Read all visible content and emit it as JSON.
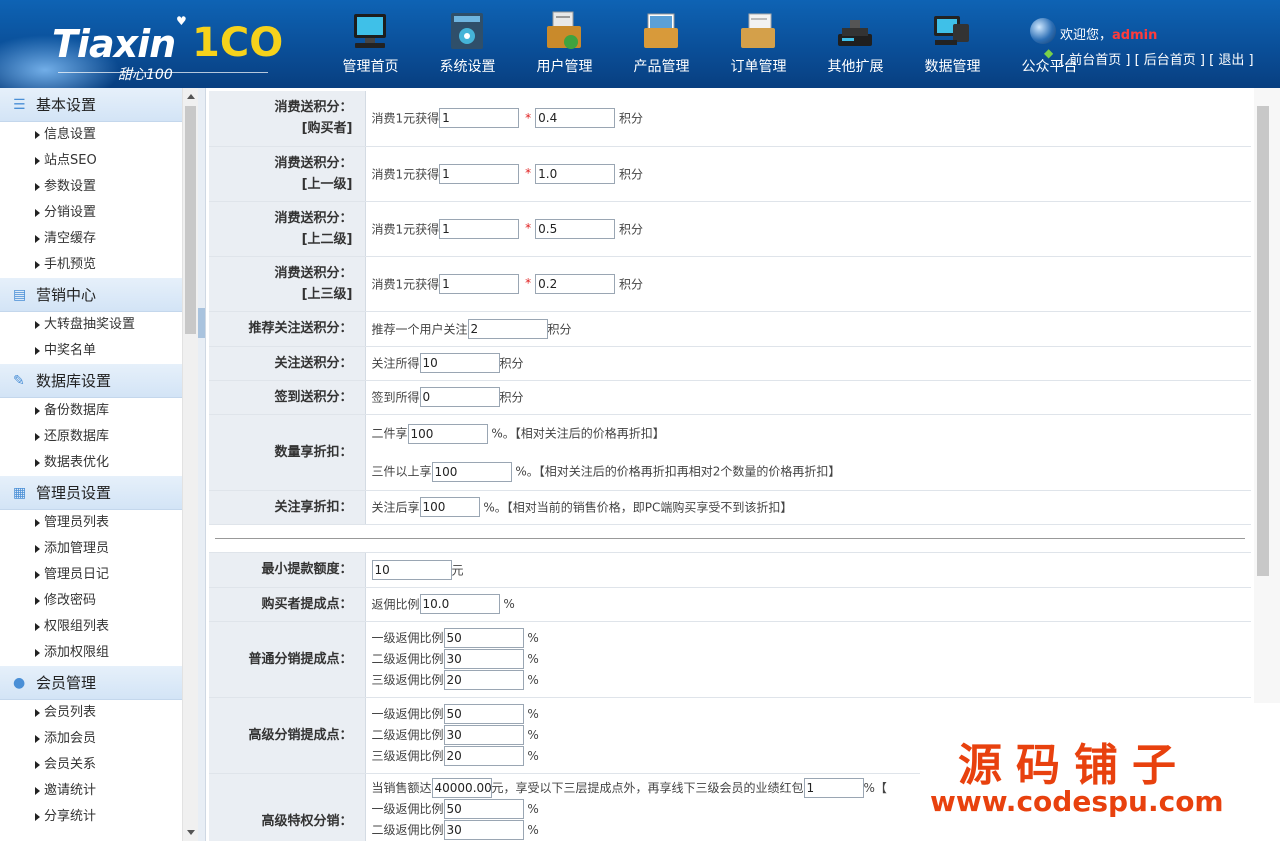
{
  "brand": {
    "logo_word": "Tiaxin",
    "logo_num": "1CO",
    "logo_sub": "甜心100"
  },
  "nav": [
    {
      "label": "管理首页",
      "icon": "monitor-icon"
    },
    {
      "label": "系统设置",
      "icon": "settings-cabinet-icon"
    },
    {
      "label": "用户管理",
      "icon": "user-folder-icon"
    },
    {
      "label": "产品管理",
      "icon": "product-folder-icon"
    },
    {
      "label": "订单管理",
      "icon": "order-folder-icon"
    },
    {
      "label": "其他扩展",
      "icon": "device-icon"
    },
    {
      "label": "数据管理",
      "icon": "data-monitor-icon"
    },
    {
      "label": "公众平台",
      "icon": "globe-icon"
    }
  ],
  "user": {
    "welcome": "欢迎您，",
    "name": "admin",
    "link_front": "[ 前台首页 ]",
    "link_back": "[ 后台首页 ]",
    "link_logout": "[ 退出 ]"
  },
  "sidebar": [
    {
      "title": "基本设置",
      "icon": "list-icon",
      "items": [
        "信息设置",
        "站点SEO",
        "参数设置",
        "分销设置",
        "清空缓存",
        "手机预览"
      ]
    },
    {
      "title": "营销中心",
      "icon": "message-icon",
      "items": [
        "大转盘抽奖设置",
        "中奖名单"
      ]
    },
    {
      "title": "数据库设置",
      "icon": "edit-icon",
      "items": [
        "备份数据库",
        "还原数据库",
        "数据表优化"
      ]
    },
    {
      "title": "管理员设置",
      "icon": "calendar-icon",
      "items": [
        "管理员列表",
        "添加管理员",
        "管理员日记",
        "修改密码",
        "权限组列表",
        "添加权限组"
      ]
    },
    {
      "title": "会员管理",
      "icon": "person-icon",
      "items": [
        "会员列表",
        "添加会员",
        "会员关系",
        "邀请统计",
        "分享统计"
      ]
    }
  ],
  "form": {
    "consume_buyer": {
      "label1": "消费送积分：",
      "label2": "[购买者]",
      "prefix": "消费1元获得",
      "a": "1",
      "b": "0.4",
      "suffix": "积分"
    },
    "consume_l1": {
      "label1": "消费送积分：",
      "label2": "[上一级]",
      "prefix": "消费1元获得",
      "a": "1",
      "b": "1.0",
      "suffix": "积分"
    },
    "consume_l2": {
      "label1": "消费送积分：",
      "label2": "[上二级]",
      "prefix": "消费1元获得",
      "a": "1",
      "b": "0.5",
      "suffix": "积分"
    },
    "consume_l3": {
      "label1": "消费送积分：",
      "label2": "[上三级]",
      "prefix": "消费1元获得",
      "a": "1",
      "b": "0.2",
      "suffix": "积分"
    },
    "recommend": {
      "label": "推荐关注送积分：",
      "prefix": "推荐一个用户关注",
      "value": "2",
      "suffix": "积分"
    },
    "follow": {
      "label": "关注送积分：",
      "prefix": "关注所得",
      "value": "10",
      "suffix": "积分"
    },
    "signin": {
      "label": "签到送积分：",
      "prefix": "签到所得",
      "value": "0",
      "suffix": "积分"
    },
    "qty_discount": {
      "label": "数量享折扣：",
      "p1": "二件享",
      "v1": "100",
      "s1": "%。【相对关注后的价格再折扣】",
      "p2": "三件以上享",
      "v2": "100",
      "s2": "%。【相对关注后的价格再折扣再相对2个数量的价格再折扣】"
    },
    "follow_discount": {
      "label": "关注享折扣：",
      "prefix": "关注后享",
      "value": "100",
      "suffix": "%。【相对当前的销售价格，即PC端购买享受不到该折扣】"
    },
    "min_withdraw": {
      "label": "最小提款额度：",
      "value": "10",
      "suffix": "元"
    },
    "buyer_commission": {
      "label": "购买者提成点：",
      "prefix": "返佣比例",
      "value": "10.0",
      "suffix": "%"
    },
    "normal_dist": {
      "label": "普通分销提成点：",
      "rows": [
        {
          "prefix": "一级返佣比例",
          "value": "50",
          "suffix": "%"
        },
        {
          "prefix": "二级返佣比例",
          "value": "30",
          "suffix": "%"
        },
        {
          "prefix": "三级返佣比例",
          "value": "20",
          "suffix": "%"
        }
      ]
    },
    "senior_dist": {
      "label": "高级分销提成点：",
      "rows": [
        {
          "prefix": "一级返佣比例",
          "value": "50",
          "suffix": "%"
        },
        {
          "prefix": "二级返佣比例",
          "value": "30",
          "suffix": "%"
        },
        {
          "prefix": "三级返佣比例",
          "value": "20",
          "suffix": "%"
        }
      ]
    },
    "senior_special": {
      "label": "高级特权分销：",
      "p0": "当销售额达",
      "v0": "40000.00",
      "m0": "元，享受以下三层提成点外，再享线下三级会员的业绩红包",
      "v0b": "1",
      "s0": "%【",
      "rows": [
        {
          "prefix": "一级返佣比例",
          "value": "50",
          "suffix": "%"
        },
        {
          "prefix": "二级返佣比例",
          "value": "30",
          "suffix": "%"
        }
      ]
    }
  },
  "watermark": {
    "line1": "源码铺子",
    "line2": "www.codespu.com"
  }
}
